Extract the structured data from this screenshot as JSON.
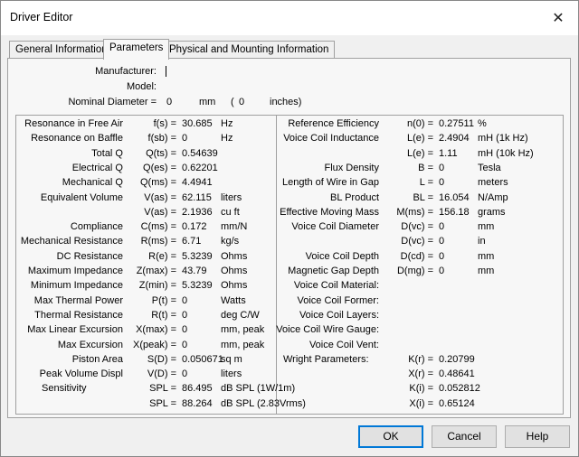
{
  "window": {
    "title": "Driver Editor",
    "close_glyph": "✕"
  },
  "tabs": [
    {
      "label": "General Information"
    },
    {
      "label": "Parameters"
    },
    {
      "label": "Physical and Mounting Information"
    }
  ],
  "header": {
    "manufacturer_label": "Manufacturer:",
    "model_label": "Model:",
    "diameter_label": "Nominal Diameter =",
    "diameter_mm": "0",
    "unit_mm": "mm",
    "paren_open": "(",
    "diameter_in": "0",
    "unit_in": "inches)"
  },
  "left_params": [
    {
      "name": "Resonance in Free Air",
      "sym": "f(s) =",
      "value": "30.685",
      "unit": "Hz"
    },
    {
      "name": "Resonance on Baffle",
      "sym": "f(sb) =",
      "value": "0",
      "unit": "Hz"
    },
    {
      "name": "Total Q",
      "sym": "Q(ts) =",
      "value": "0.54639",
      "unit": ""
    },
    {
      "name": "Electrical Q",
      "sym": "Q(es) =",
      "value": "0.62201",
      "unit": ""
    },
    {
      "name": "Mechanical Q",
      "sym": "Q(ms) =",
      "value": "4.4941",
      "unit": ""
    },
    {
      "name": "Equivalent Volume",
      "sym": "V(as) =",
      "value": "62.115",
      "unit": "liters"
    },
    {
      "name": "",
      "sym": "V(as) =",
      "value": "2.1936",
      "unit": "cu ft"
    },
    {
      "name": "Compliance",
      "sym": "C(ms) =",
      "value": "0.172",
      "unit": "mm/N"
    },
    {
      "name": "Mechanical Resistance",
      "sym": "R(ms) =",
      "value": "6.71",
      "unit": "kg/s"
    },
    {
      "name": "DC Resistance",
      "sym": "R(e) =",
      "value": "5.3239",
      "unit": "Ohms"
    },
    {
      "name": "Maximum Impedance",
      "sym": "Z(max) =",
      "value": "43.79",
      "unit": "Ohms"
    },
    {
      "name": "Minimum Impedance",
      "sym": "Z(min) =",
      "value": "5.3239",
      "unit": "Ohms"
    },
    {
      "name": "Max Thermal Power",
      "sym": "P(t) =",
      "value": "0",
      "unit": "Watts"
    },
    {
      "name": "Thermal Resistance",
      "sym": "R(t) =",
      "value": "0",
      "unit": "deg C/W"
    },
    {
      "name": "Max Linear Excursion",
      "sym": "X(max) =",
      "value": "0",
      "unit": "mm, peak"
    },
    {
      "name": "Max Excursion",
      "sym": "X(peak) =",
      "value": "0",
      "unit": "mm, peak"
    },
    {
      "name": "Piston Area",
      "sym": "S(D) =",
      "value": "0.050671",
      "unit": "sq m"
    },
    {
      "name": "Peak Volume Displ",
      "sym": "V(D) =",
      "value": "0",
      "unit": "liters"
    }
  ],
  "sensitivity": {
    "label": "Sensitivity",
    "rows": [
      {
        "sym": "SPL =",
        "value": "86.495",
        "unit": "dB SPL (1W/1m)"
      },
      {
        "sym": "SPL =",
        "value": "88.264",
        "unit": "dB SPL (2.83Vrms)"
      }
    ]
  },
  "right_params": [
    {
      "name": "Reference Efficiency",
      "sym": "n(0) =",
      "value": "0.27511",
      "unit": "%"
    },
    {
      "name": "Voice Coil Inductance",
      "sym": "L(e) =",
      "value": "2.4904",
      "unit": "mH (1k Hz)"
    },
    {
      "name": "",
      "sym": "L(e) =",
      "value": "1.11",
      "unit": "mH (10k Hz)"
    },
    {
      "name": "Flux Density",
      "sym": "B =",
      "value": "0",
      "unit": "Tesla"
    },
    {
      "name": "Length of Wire in Gap",
      "sym": "L =",
      "value": "0",
      "unit": "meters"
    },
    {
      "name": "BL Product",
      "sym": "BL =",
      "value": "16.054",
      "unit": "N/Amp"
    },
    {
      "name": "Effective Moving Mass",
      "sym": "M(ms) =",
      "value": "156.18",
      "unit": "grams"
    },
    {
      "name": "Voice Coil Diameter",
      "sym": "D(vc) =",
      "value": "0",
      "unit": "mm"
    },
    {
      "name": "",
      "sym": "D(vc) =",
      "value": "0",
      "unit": "in"
    },
    {
      "name": "Voice Coil Depth",
      "sym": "D(cd) =",
      "value": "0",
      "unit": "mm"
    },
    {
      "name": "Magnetic Gap Depth",
      "sym": "D(mg) =",
      "value": "0",
      "unit": "mm"
    },
    {
      "name": "Voice Coil Material:",
      "sym": "",
      "value": "",
      "unit": ""
    },
    {
      "name": "Voice Coil Former:",
      "sym": "",
      "value": "",
      "unit": ""
    },
    {
      "name": "Voice Coil Layers:",
      "sym": "",
      "value": "",
      "unit": ""
    },
    {
      "name": "Voice Coil Wire Gauge:",
      "sym": "",
      "value": "",
      "unit": ""
    },
    {
      "name": "Voice Coil Vent:",
      "sym": "",
      "value": "",
      "unit": ""
    }
  ],
  "wright": {
    "label": "Wright Parameters:",
    "rows": [
      {
        "sym": "K(r) =",
        "value": "0.20799"
      },
      {
        "sym": "X(r) =",
        "value": "0.48641"
      },
      {
        "sym": "K(i) =",
        "value": "0.052812"
      },
      {
        "sym": "X(i) =",
        "value": "0.65124"
      }
    ]
  },
  "buttons": {
    "ok": "OK",
    "cancel": "Cancel",
    "help": "Help"
  }
}
